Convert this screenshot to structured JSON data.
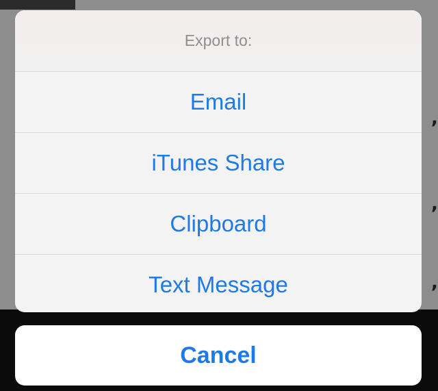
{
  "action_sheet": {
    "title": "Export to:",
    "options": [
      {
        "label": "Email"
      },
      {
        "label": "iTunes Share"
      },
      {
        "label": "Clipboard"
      },
      {
        "label": "Text Message"
      }
    ],
    "cancel_label": "Cancel"
  },
  "colors": {
    "accent": "#1d7ae6",
    "title": "#8e8e8e",
    "sheet_background": "#f4f3f3",
    "dimmed_background": "#8d8d8d"
  }
}
